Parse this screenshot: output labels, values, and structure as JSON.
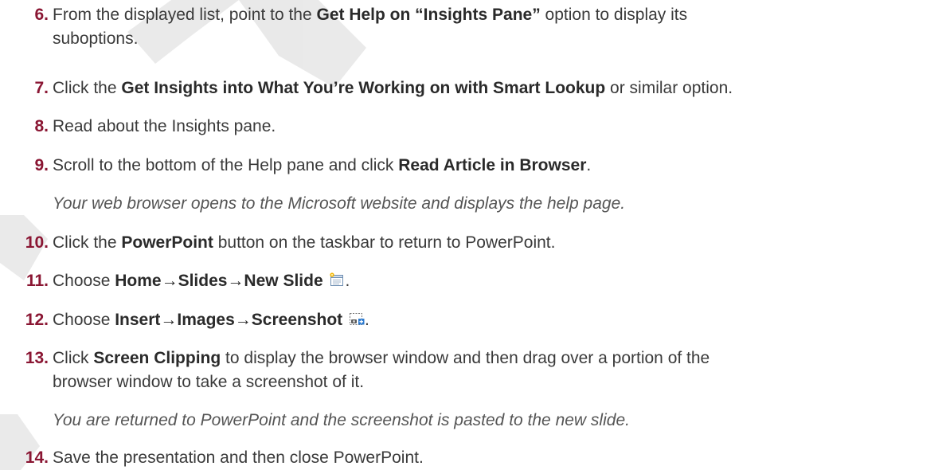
{
  "steps": [
    {
      "num": "6.",
      "lines": [
        [
          {
            "t": "From the displayed list, point to the "
          },
          {
            "t": "Get Help on “Insights Pane”",
            "b": true
          },
          {
            "t": " option to display its"
          }
        ],
        [
          {
            "t": "suboptions."
          }
        ]
      ]
    },
    {
      "num": "7.",
      "lines": [
        [
          {
            "t": "Click the "
          },
          {
            "t": "Get Insights into What You’re Working on with Smart Lookup",
            "b": true
          },
          {
            "t": " or similar option."
          }
        ]
      ]
    },
    {
      "num": "8.",
      "lines": [
        [
          {
            "t": "Read about the Insights pane."
          }
        ]
      ]
    },
    {
      "num": "9.",
      "lines": [
        [
          {
            "t": "Scroll to the bottom of the Help pane and click "
          },
          {
            "t": "Read Article in Browser",
            "b": true
          },
          {
            "t": "."
          }
        ]
      ]
    },
    {
      "num": "10.",
      "lines": [
        [
          {
            "t": "Click the "
          },
          {
            "t": "PowerPoint",
            "b": true
          },
          {
            "t": " button on the taskbar to return to PowerPoint."
          }
        ]
      ]
    },
    {
      "num": "11.",
      "lines": [
        [
          {
            "t": "Choose "
          },
          {
            "t": "Home→Slides→New Slide",
            "b": true
          },
          {
            "icon": "new-slide-icon"
          },
          {
            "t": "."
          }
        ]
      ]
    },
    {
      "num": "12.",
      "lines": [
        [
          {
            "t": "Choose "
          },
          {
            "t": "Insert→Images→Screenshot",
            "b": true
          },
          {
            "icon": "screenshot-icon"
          },
          {
            "t": "."
          }
        ]
      ]
    },
    {
      "num": "13.",
      "lines": [
        [
          {
            "t": "Click "
          },
          {
            "t": "Screen Clipping",
            "b": true
          },
          {
            "t": " to display the browser window and then drag over a portion of the"
          }
        ],
        [
          {
            "t": "browser window to take a screenshot of it."
          }
        ]
      ]
    },
    {
      "num": "14.",
      "lines": [
        [
          {
            "t": "Save the presentation and then close PowerPoint."
          }
        ]
      ]
    }
  ],
  "notes": {
    "after_step_9": "Your web browser opens to the Microsoft website and displays the help page.",
    "after_step_13": "You are returned to PowerPoint and the screenshot is pasted to the new slide."
  },
  "colors": {
    "step_number": "#8a1633",
    "watermark": "#d9d9d9",
    "body_text": "#3a3a3a",
    "note_text": "#555555"
  }
}
